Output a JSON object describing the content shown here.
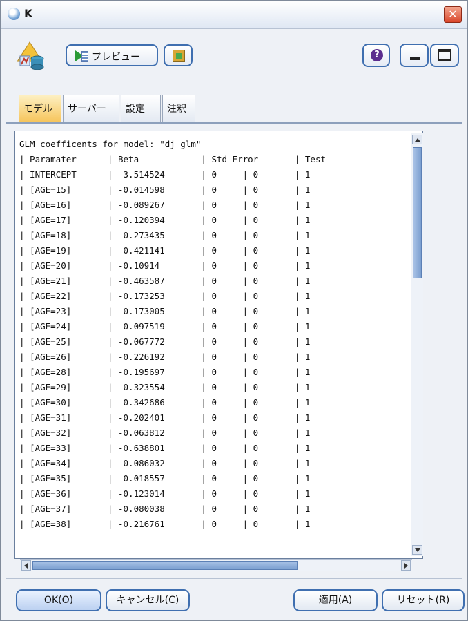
{
  "window": {
    "title": "K",
    "close_glyph": "✕"
  },
  "toolbar": {
    "preview_label": "プレビュー",
    "help_glyph": "?"
  },
  "tabs": [
    {
      "label": "モデル",
      "active": true
    },
    {
      "label": "サーバー",
      "active": false
    },
    {
      "label": "設定",
      "active": false
    },
    {
      "label": "注釈",
      "active": false
    }
  ],
  "output": {
    "header_line": "GLM coefficents for model: \"dj_glm\"",
    "columns": [
      "Paramater",
      "Beta",
      "Std Error",
      "Test"
    ],
    "rows": [
      [
        "INTERCEPT",
        "-3.514524",
        "0",
        "0",
        "1"
      ],
      [
        "[AGE=15]",
        "-0.014598",
        "0",
        "0",
        "1"
      ],
      [
        "[AGE=16]",
        "-0.089267",
        "0",
        "0",
        "1"
      ],
      [
        "[AGE=17]",
        "-0.120394",
        "0",
        "0",
        "1"
      ],
      [
        "[AGE=18]",
        "-0.273435",
        "0",
        "0",
        "1"
      ],
      [
        "[AGE=19]",
        "-0.421141",
        "0",
        "0",
        "1"
      ],
      [
        "[AGE=20]",
        "-0.10914",
        "0",
        "0",
        "1"
      ],
      [
        "[AGE=21]",
        "-0.463587",
        "0",
        "0",
        "1"
      ],
      [
        "[AGE=22]",
        "-0.173253",
        "0",
        "0",
        "1"
      ],
      [
        "[AGE=23]",
        "-0.173005",
        "0",
        "0",
        "1"
      ],
      [
        "[AGE=24]",
        "-0.097519",
        "0",
        "0",
        "1"
      ],
      [
        "[AGE=25]",
        "-0.067772",
        "0",
        "0",
        "1"
      ],
      [
        "[AGE=26]",
        "-0.226192",
        "0",
        "0",
        "1"
      ],
      [
        "[AGE=28]",
        "-0.195697",
        "0",
        "0",
        "1"
      ],
      [
        "[AGE=29]",
        "-0.323554",
        "0",
        "0",
        "1"
      ],
      [
        "[AGE=30]",
        "-0.342686",
        "0",
        "0",
        "1"
      ],
      [
        "[AGE=31]",
        "-0.202401",
        "0",
        "0",
        "1"
      ],
      [
        "[AGE=32]",
        "-0.063812",
        "0",
        "0",
        "1"
      ],
      [
        "[AGE=33]",
        "-0.638801",
        "0",
        "0",
        "1"
      ],
      [
        "[AGE=34]",
        "-0.086032",
        "0",
        "0",
        "1"
      ],
      [
        "[AGE=35]",
        "-0.018557",
        "0",
        "0",
        "1"
      ],
      [
        "[AGE=36]",
        "-0.123014",
        "0",
        "0",
        "1"
      ],
      [
        "[AGE=37]",
        "-0.080038",
        "0",
        "0",
        "1"
      ],
      [
        "[AGE=38]",
        "-0.216761",
        "0",
        "0",
        "1"
      ]
    ]
  },
  "footer": {
    "ok_label": "OK(O)",
    "cancel_label": "キャンセル(C)",
    "apply_label": "適用(A)",
    "reset_label": "リセット(R)"
  },
  "colors": {
    "accent": "#3f6fb0",
    "active_tab": "#f6c45a",
    "close": "#d9462b"
  }
}
